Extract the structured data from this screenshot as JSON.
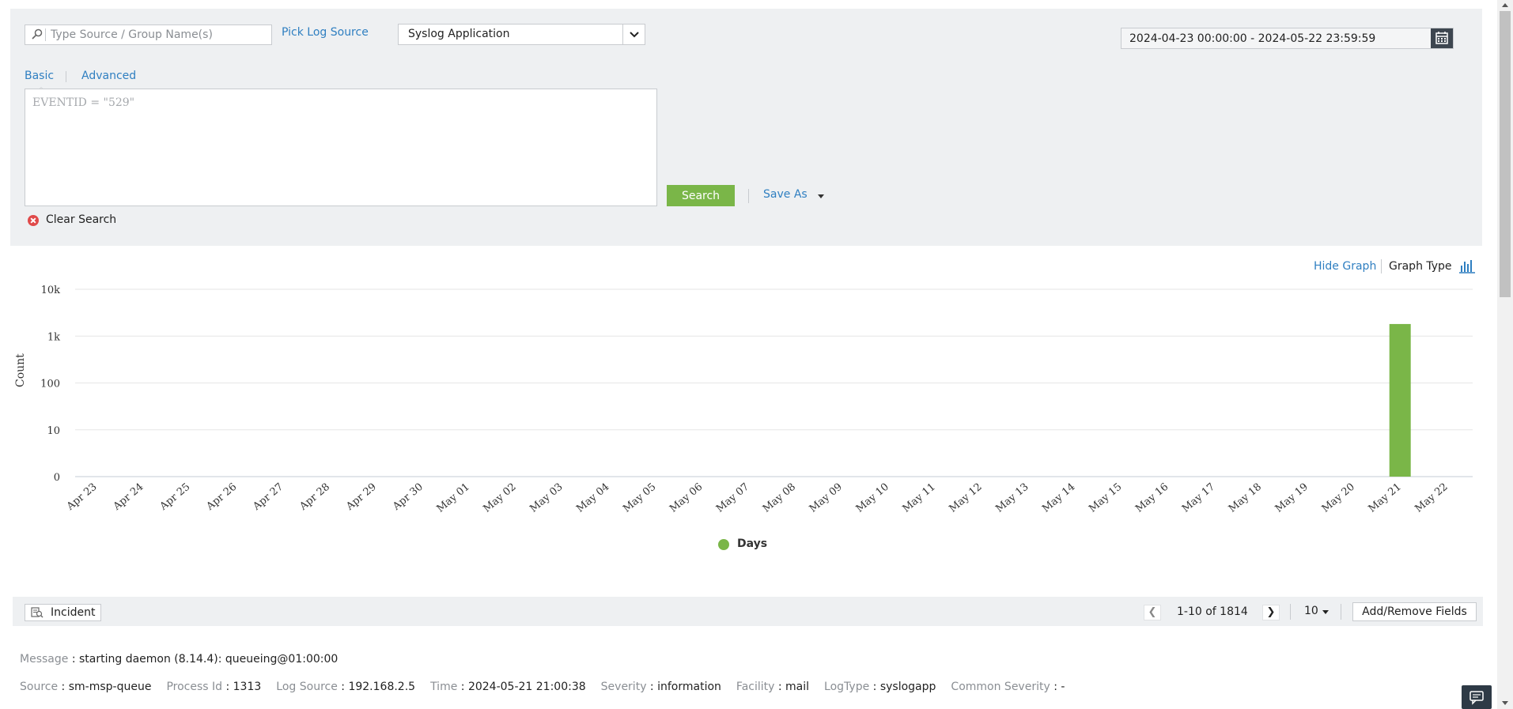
{
  "search": {
    "source_placeholder": "Type Source / Group Name(s)",
    "source_value": "",
    "pick_log_source": "Pick Log Source",
    "log_type_selected": "Syslog Application",
    "date_range": "2024-04-23 00:00:00 - 2024-05-22 23:59:59",
    "tabs": [
      "Basic",
      "Advanced"
    ],
    "active_tab": "Basic",
    "query_placeholder": "EVENTID = \"529\"",
    "query_value": "",
    "search_button": "Search",
    "save_as": "Save As",
    "clear_search": "Clear Search"
  },
  "graph_controls": {
    "hide_graph": "Hide Graph",
    "graph_type": "Graph Type"
  },
  "chart_data": {
    "type": "bar",
    "ylabel": "Count",
    "xlabel": "",
    "title": "",
    "yscale": "log",
    "yticks": [
      "0",
      "10",
      "100",
      "1k",
      "10k"
    ],
    "categories": [
      "Apr 23",
      "Apr 24",
      "Apr 25",
      "Apr 26",
      "Apr 27",
      "Apr 28",
      "Apr 29",
      "Apr 30",
      "May 01",
      "May 02",
      "May 03",
      "May 04",
      "May 05",
      "May 06",
      "May 07",
      "May 08",
      "May 09",
      "May 10",
      "May 11",
      "May 12",
      "May 13",
      "May 14",
      "May 15",
      "May 16",
      "May 17",
      "May 18",
      "May 19",
      "May 20",
      "May 21",
      "May 22"
    ],
    "series": [
      {
        "name": "Days",
        "color": "#7ab648",
        "values": [
          0,
          0,
          0,
          0,
          0,
          0,
          0,
          0,
          0,
          0,
          0,
          0,
          0,
          0,
          0,
          0,
          0,
          0,
          0,
          0,
          0,
          0,
          0,
          0,
          0,
          0,
          0,
          0,
          1814,
          0
        ]
      }
    ],
    "legend_position": "bottom-center",
    "grid": true
  },
  "toolbar": {
    "incident": "Incident",
    "pagination": "1-10 of 1814",
    "per_page": "10",
    "add_remove_fields": "Add/Remove Fields"
  },
  "record": {
    "message_key": "Message",
    "message_val": "starting daemon (8.14.4): queueing@01:00:00",
    "fields": [
      {
        "key": "Source",
        "val": "sm-msp-queue"
      },
      {
        "key": "Process Id",
        "val": "1313"
      },
      {
        "key": "Log Source",
        "val": "192.168.2.5"
      },
      {
        "key": "Time",
        "val": "2024-05-21 21:00:38"
      },
      {
        "key": "Severity",
        "val": "information"
      },
      {
        "key": "Facility",
        "val": "mail"
      },
      {
        "key": "LogType",
        "val": "syslogapp"
      },
      {
        "key": "Common Severity",
        "val": "-"
      }
    ]
  },
  "icons": {
    "search": "search-icon",
    "dropdown": "chevron-down-icon",
    "calendar": "calendar-icon",
    "clear": "clear-icon",
    "graph_type": "bar-chart-icon",
    "incident": "incident-icon",
    "chat": "chat-icon"
  },
  "colors": {
    "accent": "#2f7fc1",
    "search_button": "#7ab648",
    "bar": "#7ab648",
    "panel_bg": "#eef0f2"
  }
}
